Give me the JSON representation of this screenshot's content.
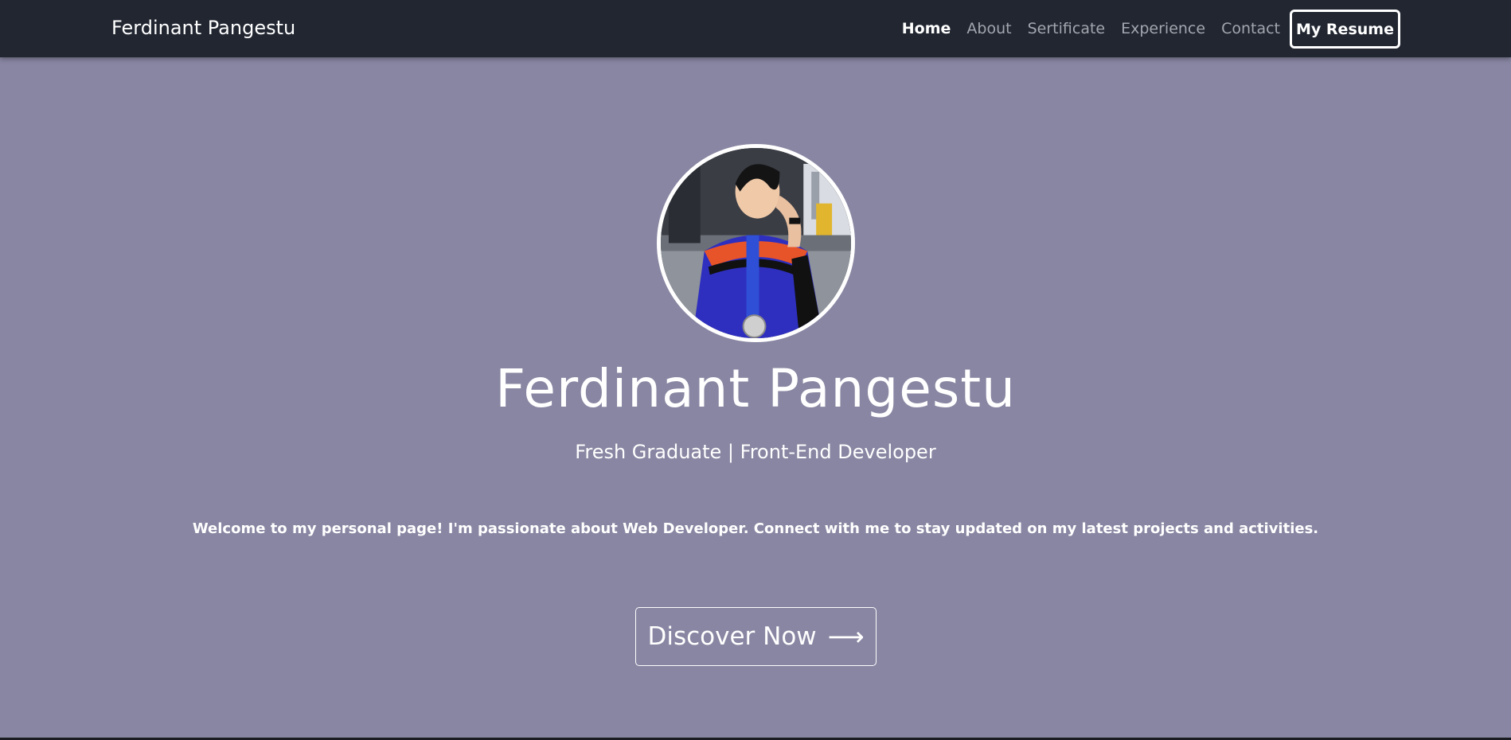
{
  "navbar": {
    "brand": "Ferdinant Pangestu",
    "links": [
      {
        "label": "Home",
        "active": true
      },
      {
        "label": "About",
        "active": false
      },
      {
        "label": "Sertificate",
        "active": false
      },
      {
        "label": "Experience",
        "active": false
      },
      {
        "label": "Contact",
        "active": false
      }
    ],
    "resume_label": "My Resume"
  },
  "hero": {
    "name": "Ferdinant Pangestu",
    "subtitle": "Fresh Graduate | Front-End Developer",
    "welcome": "Welcome to my personal page! I'm passionate about Web Developer. Connect with me to stay updated on my latest projects and activities.",
    "cta_label": "Discover Now",
    "cta_icon": "arrow-right-icon",
    "avatar_icon": "profile-photo"
  },
  "colors": {
    "navbar_bg": "#212631",
    "page_bg": "#8886a2",
    "text_primary": "#ffffff",
    "nav_inactive": "#a2a6ae"
  }
}
